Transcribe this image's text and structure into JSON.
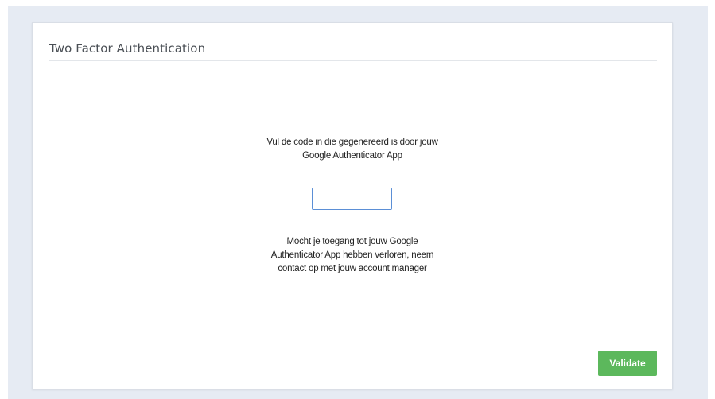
{
  "card": {
    "title": "Two Factor Authentication"
  },
  "form": {
    "instruction_line1": "Vul de code in die gegenereerd is door jouw",
    "instruction_line2": "Google Authenticator App",
    "code_value": "",
    "help_line1": "Mocht je toegang tot jouw Google",
    "help_line2": "Authenticator App hebben verloren, neem",
    "help_line3": "contact op met jouw account manager",
    "validate_label": "Validate"
  },
  "colors": {
    "page_background": "#e6ebf3",
    "accent_button": "#5cb85c",
    "input_focus_border": "#5b8fd6"
  }
}
